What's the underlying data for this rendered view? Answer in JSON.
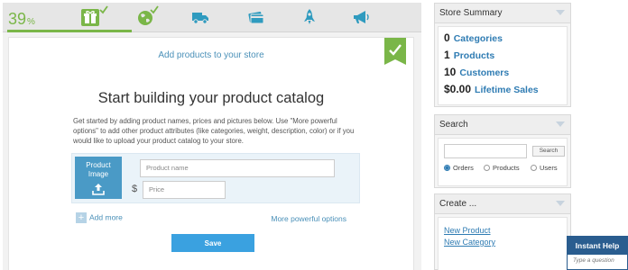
{
  "progress": {
    "value": "39",
    "unit": "%",
    "percent": 0.39
  },
  "steps": [
    {
      "icon": "gift-icon",
      "completed": true
    },
    {
      "icon": "globe-icon",
      "completed": true
    },
    {
      "icon": "truck-icon",
      "completed": false
    },
    {
      "icon": "credit-card-icon",
      "completed": false
    },
    {
      "icon": "rocket-icon",
      "completed": false
    },
    {
      "icon": "megaphone-icon",
      "completed": false
    }
  ],
  "main": {
    "subtitle": "Add products to your store",
    "headline": "Start building your product catalog",
    "description": "Get started by adding product names, prices and pictures below. Use \"More powerful options\" to add other product attributes (like categories, weight, description, color) or if you would like to upload your product catalog to your store.",
    "product_image_label": "Product Image",
    "product_name_placeholder": "Product name",
    "currency_symbol": "$",
    "price_placeholder": "Price",
    "add_more": "Add more",
    "more_options": "More powerful options",
    "save": "Save"
  },
  "sidebar": {
    "summary": {
      "title": "Store Summary",
      "stats": [
        {
          "num": "0",
          "label": "Categories"
        },
        {
          "num": "1",
          "label": "Products"
        },
        {
          "num": "10",
          "label": "Customers"
        },
        {
          "num": "$0.00",
          "label": "Lifetime Sales"
        }
      ]
    },
    "search": {
      "title": "Search",
      "input_value": "",
      "button": "Search",
      "options": [
        "Orders",
        "Products",
        "Users"
      ],
      "selected": "Orders"
    },
    "create": {
      "title": "Create ...",
      "links": [
        "New Product",
        "New Category"
      ]
    }
  },
  "help": {
    "title": "Instant Help",
    "placeholder": "Type a question"
  },
  "colors": {
    "accent_green": "#7ab648",
    "accent_blue": "#3aa1e0",
    "link_blue": "#2f7cb3",
    "help_blue": "#2a5d8f"
  }
}
